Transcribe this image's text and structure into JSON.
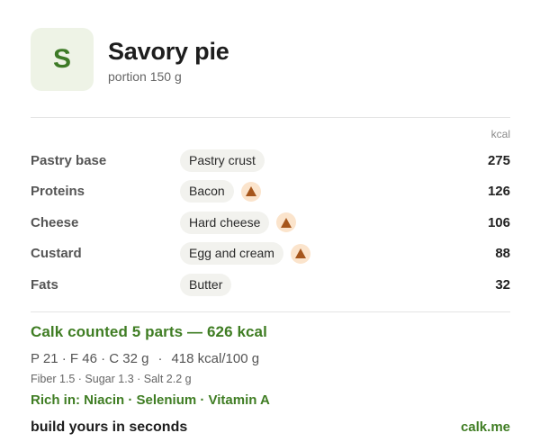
{
  "header": {
    "avatar_letter": "S",
    "title": "Savory pie",
    "subtitle": "portion 150 g"
  },
  "table": {
    "unit_header": "kcal",
    "rows": [
      {
        "label": "Pastry base",
        "ingredient": "Pastry crust",
        "kcal": "275",
        "warning": false
      },
      {
        "label": "Proteins",
        "ingredient": "Bacon",
        "kcal": "126",
        "warning": true
      },
      {
        "label": "Cheese",
        "ingredient": "Hard cheese",
        "kcal": "106",
        "warning": true
      },
      {
        "label": "Custard",
        "ingredient": "Egg and cream",
        "kcal": "88",
        "warning": true
      },
      {
        "label": "Fats",
        "ingredient": "Butter",
        "kcal": "32",
        "warning": false
      }
    ]
  },
  "summary": {
    "headline": "Calk counted 5 parts — 626 kcal",
    "macros": "P 21 · F 46 · C 32 g",
    "per100": "418 kcal/100 g",
    "macro_separator": "·",
    "details": "Fiber 1.5 · Sugar 1.3 · Salt 2.2 g",
    "rich_in": "Rich in: Niacin · Selenium · Vitamin A"
  },
  "footer": {
    "cta": "build yours in seconds",
    "site": "calk.me"
  },
  "colors": {
    "accent_green": "#3f7d23",
    "warning_fill": "#fbe4cc",
    "warning_icon": "#a6561c",
    "avatar_bg": "#eef3e6",
    "chip_bg": "#f2f2ee"
  },
  "icons": {
    "warning": "warning-triangle-icon"
  }
}
